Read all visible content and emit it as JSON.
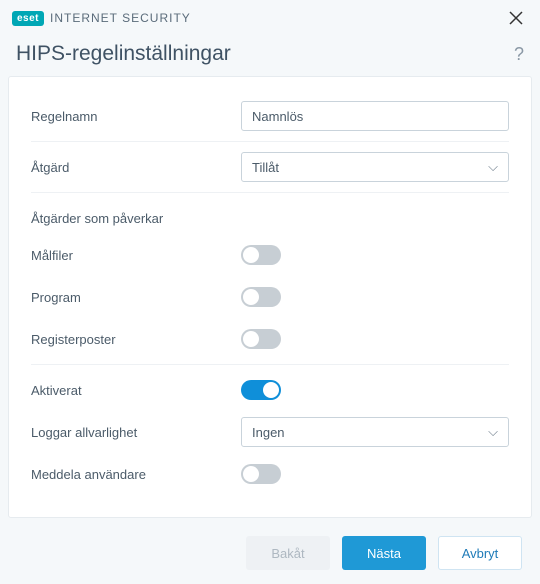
{
  "brand": {
    "badge": "eset",
    "product": "INTERNET SECURITY"
  },
  "page_title": "HIPS-regelinställningar",
  "labels": {
    "rule_name": "Regelnamn",
    "action": "Åtgärd",
    "affecting_section": "Åtgärder som påverkar",
    "target_files": "Målfiler",
    "programs": "Program",
    "registry": "Registerposter",
    "enabled": "Aktiverat",
    "log_severity": "Loggar allvarlighet",
    "notify_user": "Meddela användare"
  },
  "values": {
    "rule_name": "Namnlös",
    "action": "Tillåt",
    "target_files": false,
    "programs": false,
    "registry": false,
    "enabled": true,
    "log_severity": "Ingen",
    "notify_user": false
  },
  "buttons": {
    "back": "Bakåt",
    "next": "Nästa",
    "cancel": "Avbryt"
  }
}
